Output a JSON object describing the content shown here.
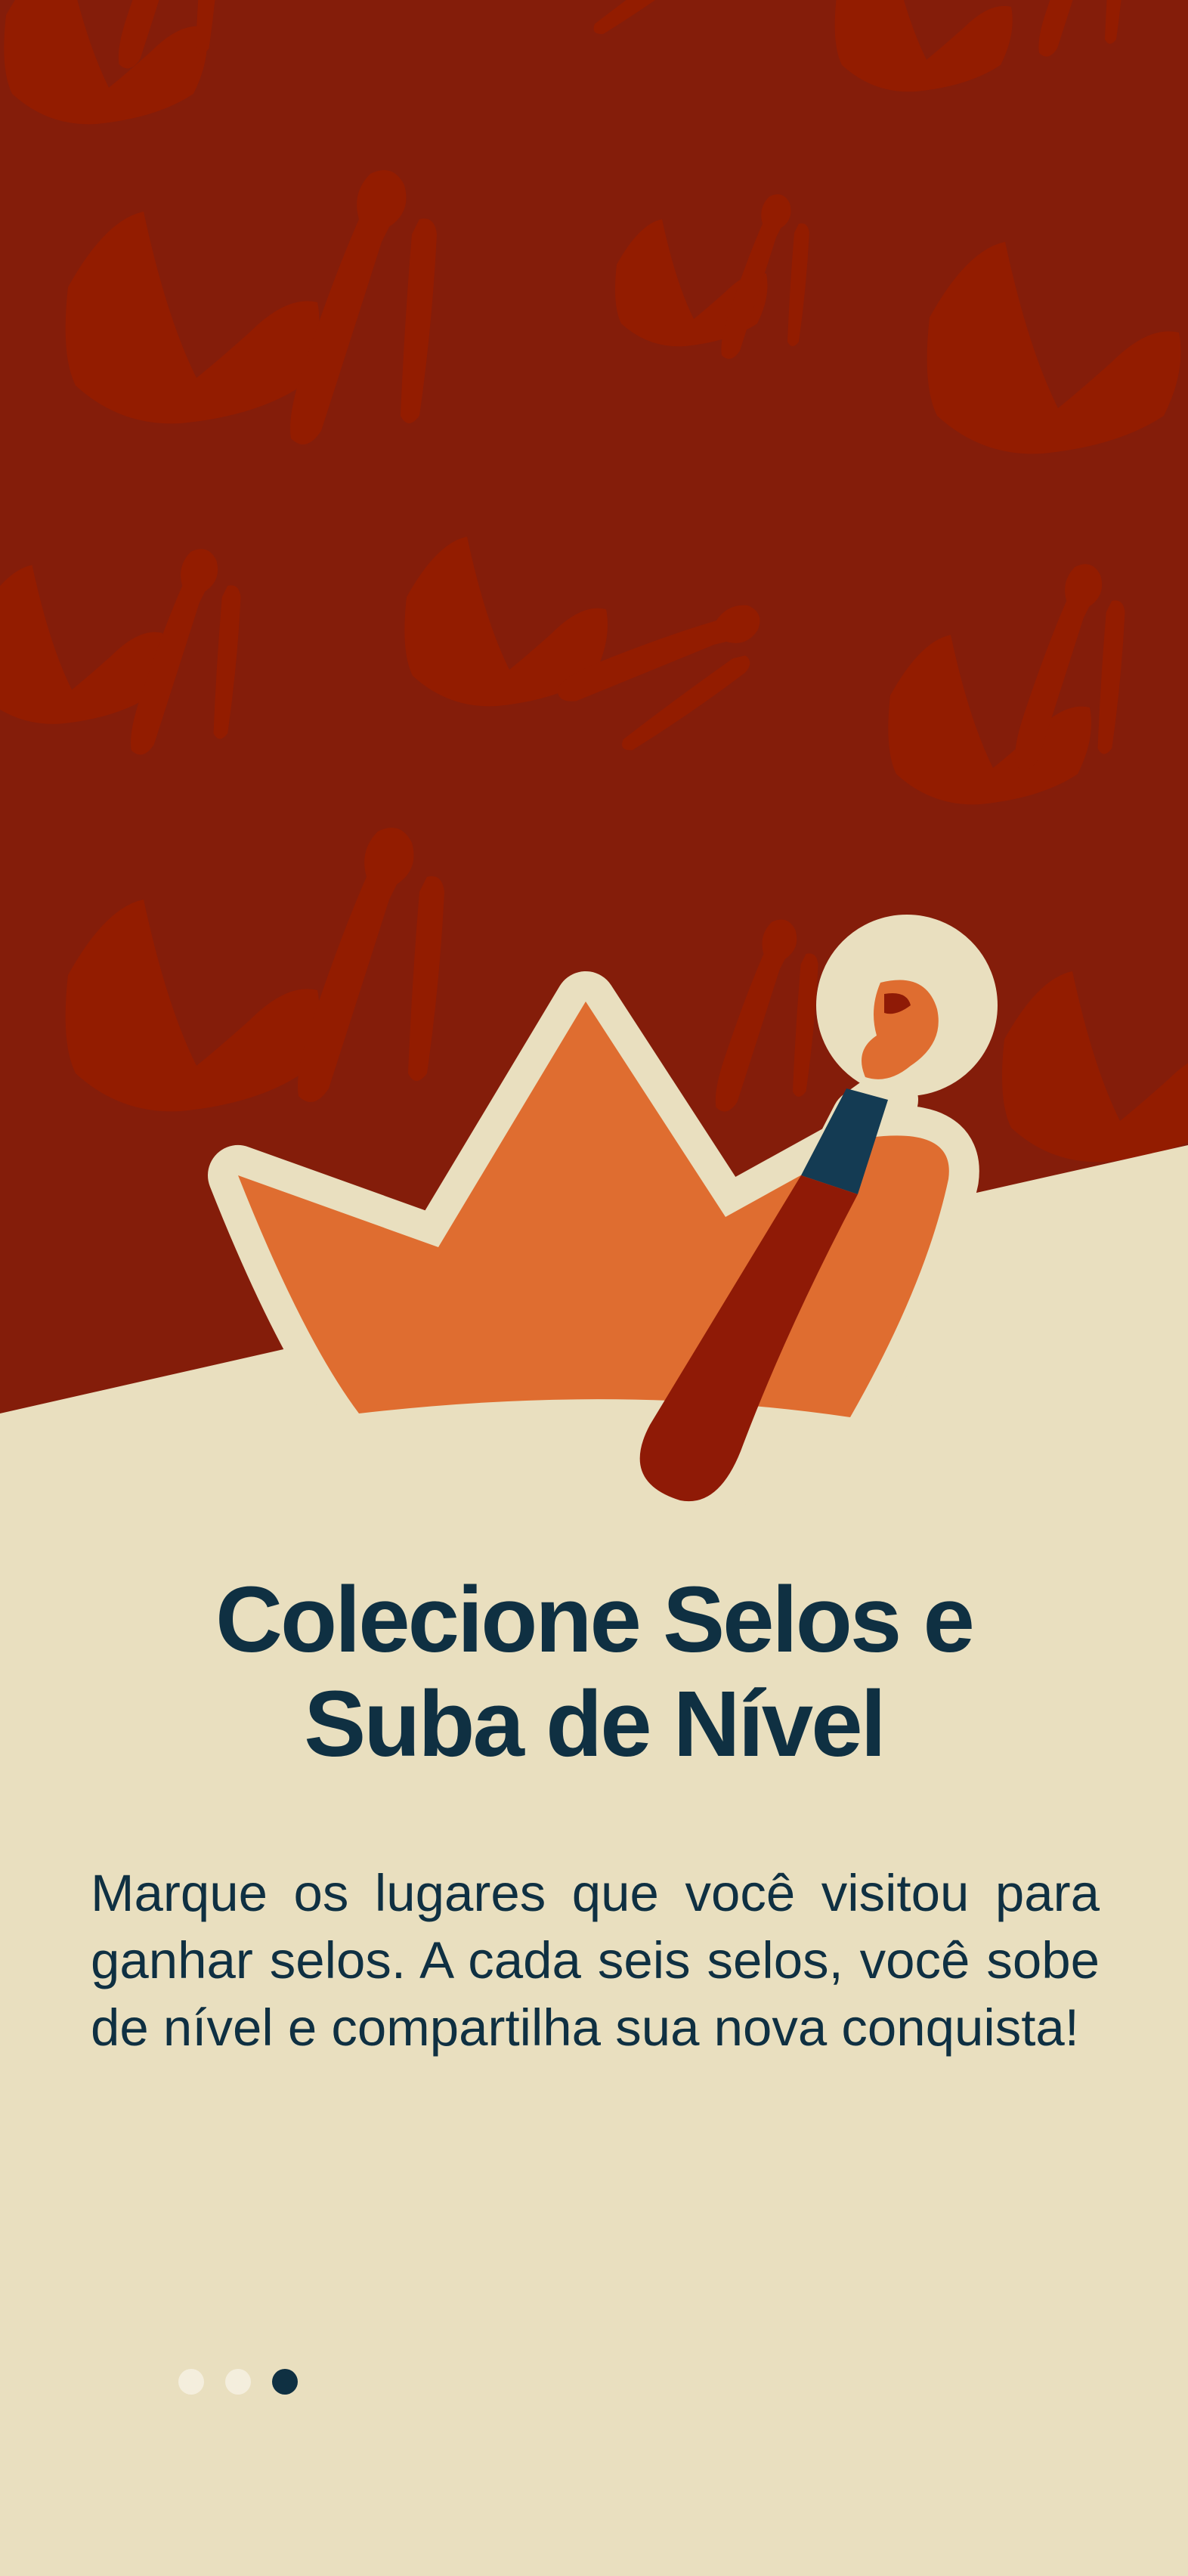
{
  "onboarding": {
    "title_line1": "Colecione Selos e",
    "title_line2": "Suba de Nível",
    "description": "Marque os lugares que você visitou para ganhar selos. A cada seis selos, você sobe de nível e compartilha sua nova conquista!",
    "illustration_icon": "crown-with-paintbrush-icon",
    "background_pattern_icons": [
      "crown-icon",
      "paintbrush-icon"
    ],
    "pagination": {
      "total_pages": 3,
      "current_page": 3
    }
  },
  "colors": {
    "background_top": "#841d0a",
    "pattern": "#931c00",
    "cream": "#e9dfbf",
    "crown": "#df6d30",
    "brush_handle": "#8f1a06",
    "brush_ferrule": "#143b53",
    "text": "#0f3042"
  }
}
